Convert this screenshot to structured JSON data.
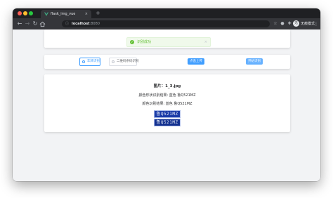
{
  "browser": {
    "tab_title": "flask_img_vue",
    "tab_close": "×",
    "new_tab": "+",
    "address_host": "localhost",
    "address_port": ":8080",
    "profile_initial": "无",
    "profile_label": "无痕模式"
  },
  "toast": {
    "message": "识别成功",
    "close": "×",
    "color": "#67c23a"
  },
  "controls": {
    "mode_options": [
      "车牌识别",
      "二维码条码识别"
    ],
    "selected_mode": "车牌识别",
    "upload_label": "点击上传",
    "recognize_label": "开始识别",
    "accent": "#409eff"
  },
  "result": {
    "title": "图片：1_3.jpg",
    "shape_result": "颜色形状识别结果: 蓝色 鲁Q521MZ",
    "color_result": "颜色识别结果: 蓝色 鲁Q521MZ",
    "plate_1": "鲁Q521MZ",
    "plate_2": "鲁Q521MZ"
  }
}
